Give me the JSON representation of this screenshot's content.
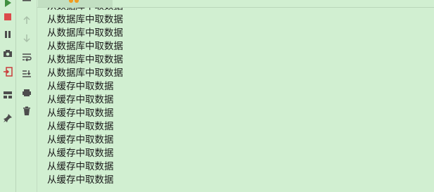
{
  "toolbar": {
    "left_icons": [
      {
        "name": "rerun-icon",
        "color": "#3f8f3f"
      },
      {
        "name": "stop-icon",
        "color": "#db4b4b"
      },
      {
        "name": "pause-icon",
        "color": "#4d4d4d"
      },
      {
        "name": "camera-icon",
        "color": "#4d4d4d"
      },
      {
        "name": "exit-icon",
        "color": "#c93b3b"
      },
      {
        "name": "layout-icon",
        "color": "#4d4d4d"
      },
      {
        "name": "pin-icon",
        "color": "#4d4d4d"
      }
    ],
    "mid_icons": [
      {
        "name": "up-arrow-icon",
        "color": "#a8bfa8"
      },
      {
        "name": "down-arrow-icon",
        "color": "#a8bfa8"
      },
      {
        "name": "soft-wrap-icon",
        "color": "#4d4d4d"
      },
      {
        "name": "scroll-to-end-icon",
        "color": "#4d4d4d"
      },
      {
        "name": "print-icon",
        "color": "#4d4d4d"
      },
      {
        "name": "trash-icon",
        "color": "#4d4d4d"
      }
    ]
  },
  "console": {
    "lines": [
      "从数据库中取数据",
      "从数据库中取数据",
      "从数据库中取数据",
      "从数据库中取数据",
      "从数据库中取数据",
      "从数据库中取数据",
      "从缓存中取数据",
      "从缓存中取数据",
      "从缓存中取数据",
      "从缓存中取数据",
      "从缓存中取数据",
      "从缓存中取数据",
      "从缓存中取数据",
      "从缓存中取数据"
    ]
  },
  "colors": {
    "background": "#d1efd1",
    "text": "#1a1a1a",
    "tab_accent": "#f19c1f"
  }
}
